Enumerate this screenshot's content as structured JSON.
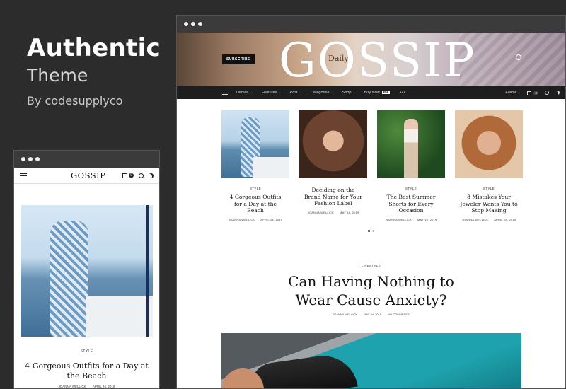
{
  "promo": {
    "title": "Authentic",
    "subtitle": "Theme",
    "byline": "By codesupplyco"
  },
  "desktop": {
    "hero": {
      "subscribe_label": "SUBSCRIBE",
      "logo": "GOSSIP",
      "logo_sub": "Daily"
    },
    "nav": {
      "items": [
        {
          "label": "Demos"
        },
        {
          "label": "Features"
        },
        {
          "label": "Post"
        },
        {
          "label": "Categories"
        },
        {
          "label": "Shop"
        },
        {
          "label": "Buy Now"
        }
      ],
      "badge": "$59",
      "follow_label": "Follow",
      "cart_count": "0",
      "more_label": "•••"
    },
    "cards": [
      {
        "category": "STYLE",
        "title": "4 Gorgeous Outfits for a Day at the Beach",
        "author": "JOANNA WELLICK",
        "date": "APRIL 24, 2019"
      },
      {
        "category": "",
        "title": "Deciding on the Brand Name for Your Fashion Label",
        "author": "JOANNA WELLICK",
        "date": "MAY 16, 2019"
      },
      {
        "category": "STYLE",
        "title": "The Best Summer Shorts for Every Occasion",
        "author": "JOANNA WELLICK",
        "date": "MAY 10, 2019"
      },
      {
        "category": "STYLE",
        "title": "8 Mistakes Your Jeweler Wants You to Stop Making",
        "author": "JOANNA WELLICK",
        "date": "APRIL 28, 2019"
      }
    ],
    "feature": {
      "category": "LIFESTYLE",
      "title_line1": "Can Having Nothing to",
      "title_line2": "Wear Cause Anxiety?",
      "author": "JOANNA WELLICK",
      "date": "MAY 24, 2019",
      "comments": "NO COMMENTS"
    }
  },
  "mobile": {
    "logo": "GOSSIP",
    "cart_count": "0",
    "category": "STYLE",
    "title": "4 Gorgeous Outfits for a Day at the Beach",
    "author": "JOANNA WELLICK",
    "date": "APRIL 24, 2019"
  }
}
